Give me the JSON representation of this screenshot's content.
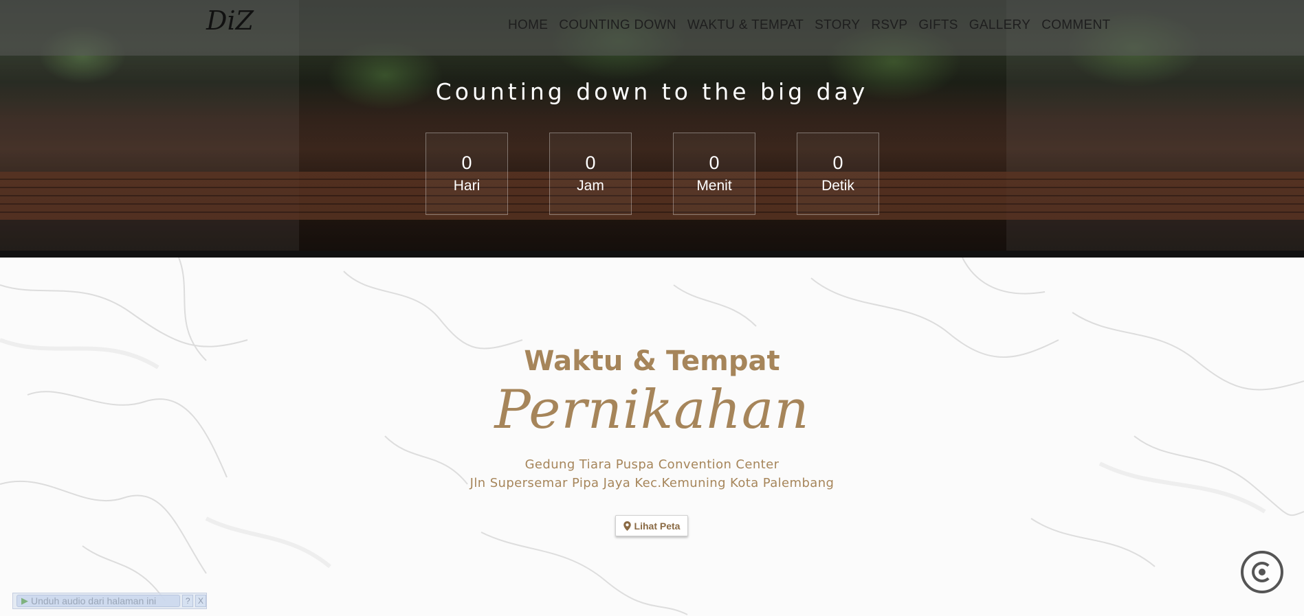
{
  "brand": "DiZ",
  "nav": [
    "HOME",
    "COUNTING DOWN",
    "WAKTU & TEMPAT",
    "STORY",
    "RSVP",
    "GIFTS",
    "GALLERY",
    "COMMENT"
  ],
  "countdown": {
    "title": "Counting down to the big day",
    "units": [
      {
        "value": "0",
        "label": "Hari"
      },
      {
        "value": "0",
        "label": "Jam"
      },
      {
        "value": "0",
        "label": "Menit"
      },
      {
        "value": "0",
        "label": "Detik"
      }
    ]
  },
  "venue": {
    "heading": "Waktu & Tempat",
    "subheading": "Pernikahan",
    "line1": "Gedung Tiara Puspa Convention Center",
    "line2": "Jln Supersemar Pipa Jaya Kec.Kemuning Kota Palembang",
    "map_button": "Lihat Peta",
    "map_icon": "map-marker-icon"
  },
  "audio_bar": {
    "download_label": "Unduh audio dari halaman ini",
    "help": "?",
    "close": "X"
  },
  "music_icon": "music-toggle-icon"
}
